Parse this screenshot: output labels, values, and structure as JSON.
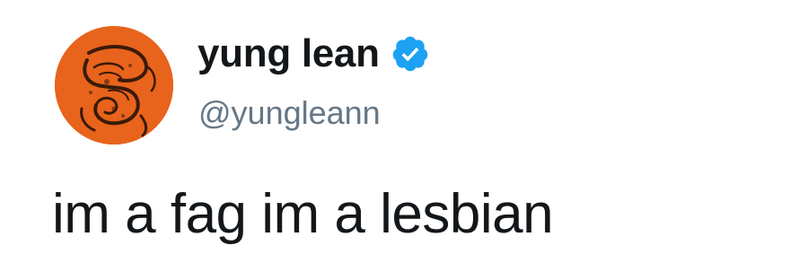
{
  "tweet": {
    "display_name": "yung lean",
    "handle": "@yungleann",
    "text": "im a fag im a lesbian",
    "verified": true,
    "avatar_icon": "snake-coil-avatar",
    "verified_icon": "verified-badge-icon"
  },
  "colors": {
    "avatar_background": "#e8631c",
    "avatar_lines": "#3a1a08",
    "verified_badge": "#1da1f2",
    "name_text": "#14171a",
    "handle_text": "#657786",
    "body_text": "#14171a"
  }
}
